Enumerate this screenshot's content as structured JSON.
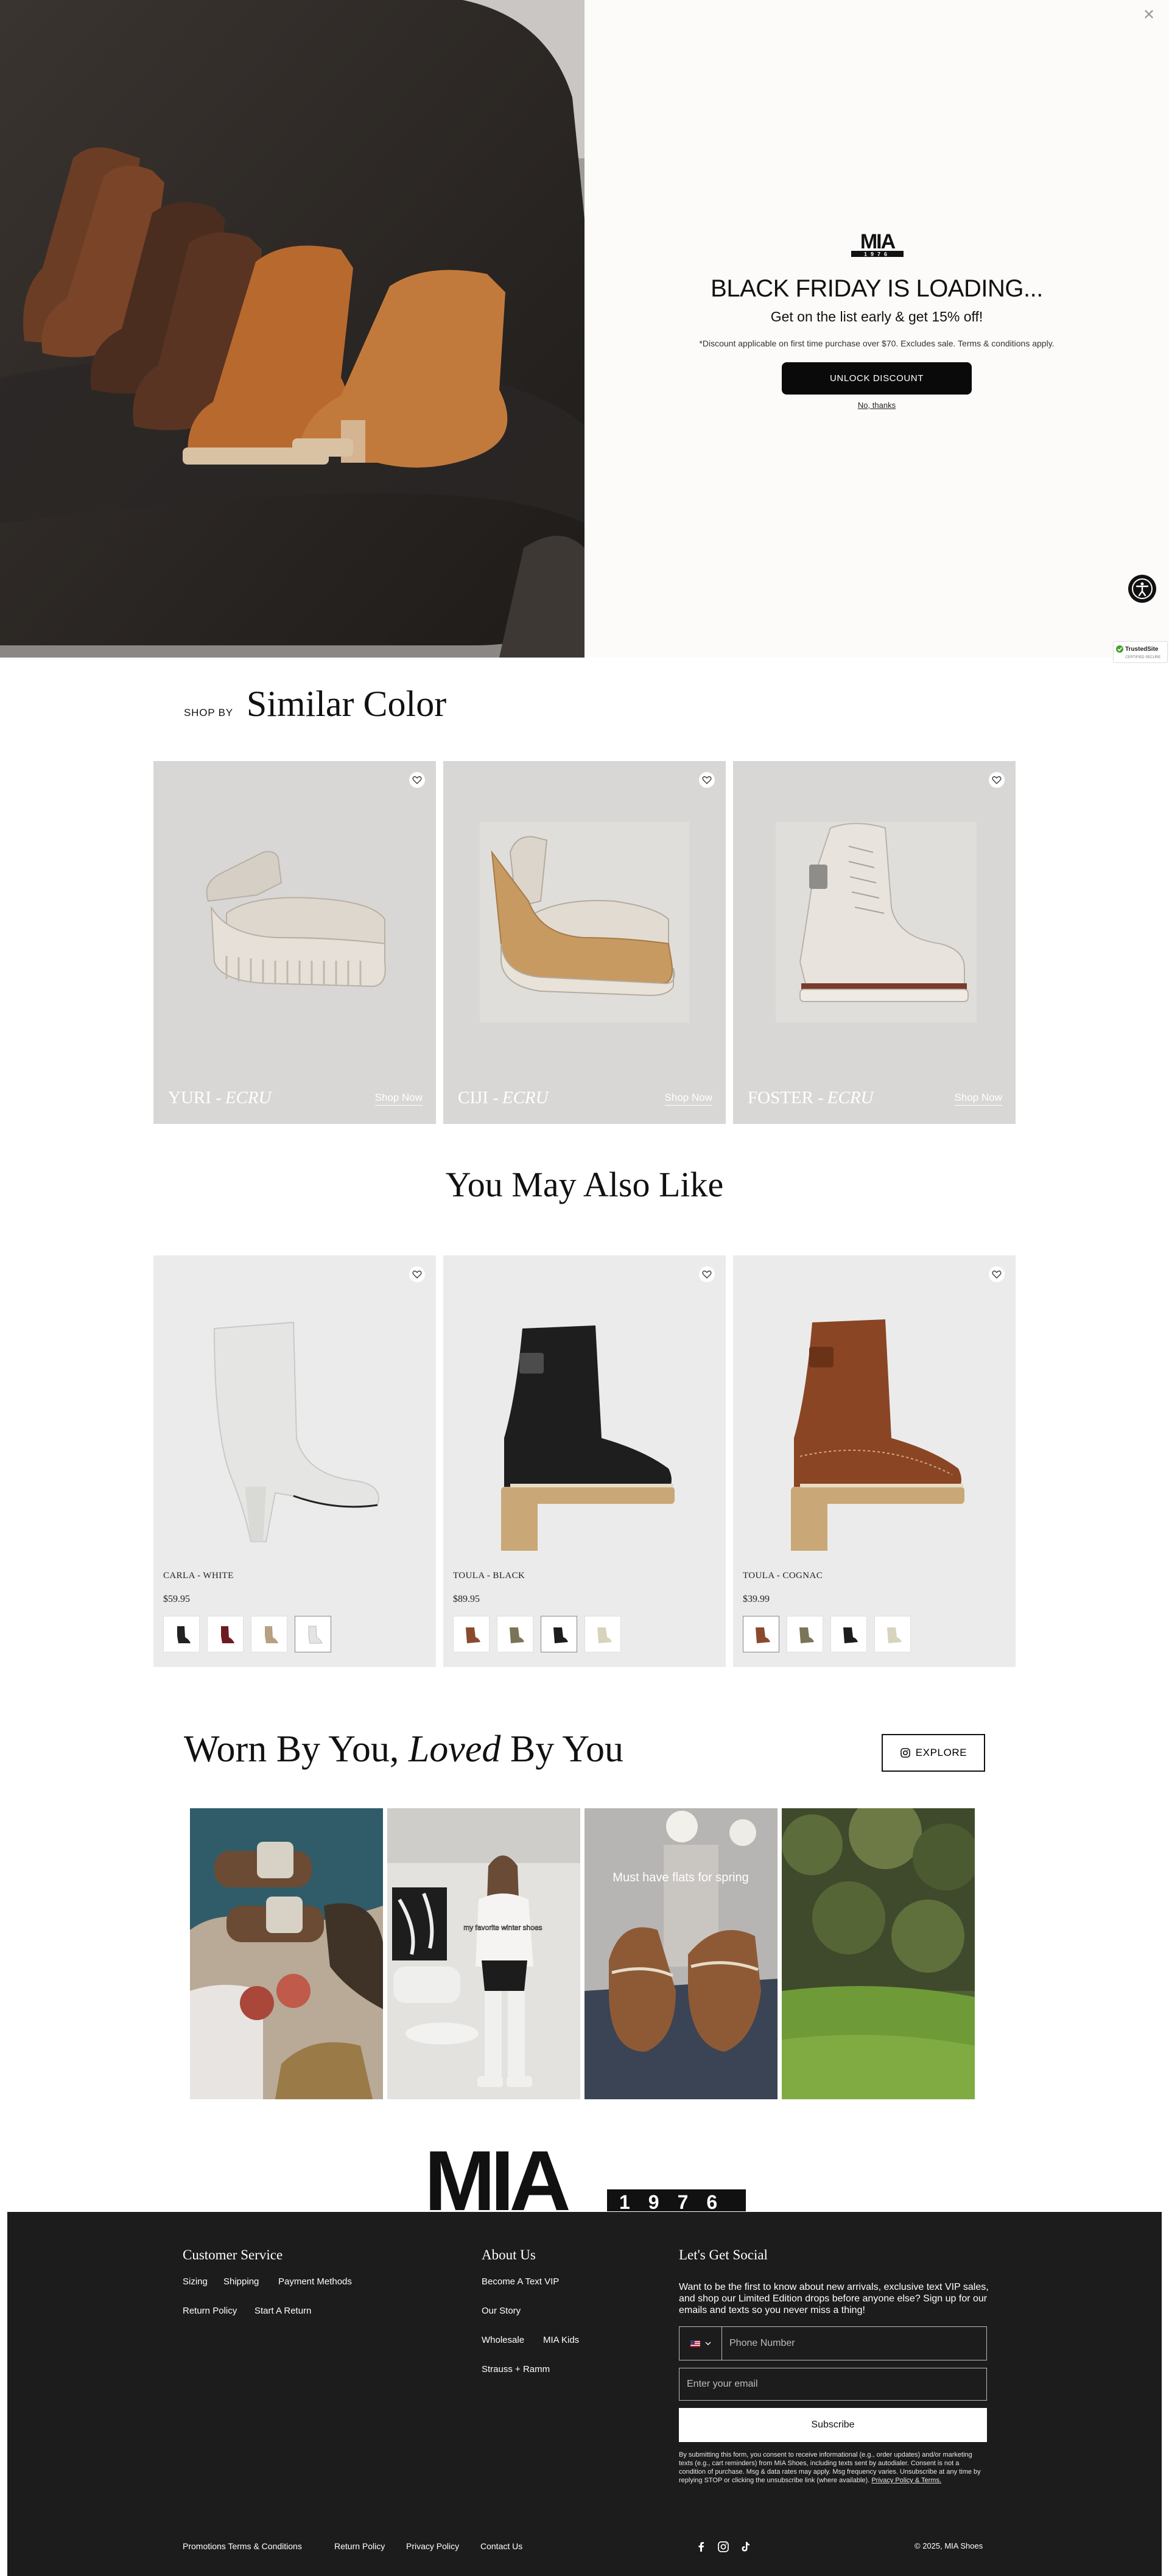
{
  "popup": {
    "close_icon": "close-icon",
    "logo_text": "MIA",
    "logo_year": "1976",
    "headline": "BLACK FRIDAY IS LOADING...",
    "subheadline": "Get on the list early & get 15% off!",
    "terms": "*Discount applicable on first time purchase over $70. Excludes sale. Terms & conditions apply.",
    "unlock_label": "UNLOCK DISCOUNT",
    "no_thanks_label": "No, thanks"
  },
  "badge": {
    "line1": "TrustedSite",
    "line2": "CERTIFIED SECURE"
  },
  "similar": {
    "shop_by": "SHOP BY",
    "title": "Similar Color",
    "cards": [
      {
        "name": "YURI",
        "color": "ECRU",
        "cta": "Shop Now"
      },
      {
        "name": "CIJI",
        "color": "ECRU",
        "cta": "Shop Now"
      },
      {
        "name": "FOSTER",
        "color": "ECRU",
        "cta": "Shop Now"
      }
    ]
  },
  "ymal": {
    "title": "You May Also Like",
    "products": [
      {
        "name": "CARLA - WHITE",
        "price": "$59.95",
        "swatches": [
          "#222222",
          "#6d1a22",
          "#b7a082",
          "#e4e4e4"
        ]
      },
      {
        "name": "TOULA - BLACK",
        "price": "$89.95",
        "swatches": [
          "#8a4a2c",
          "#7a7458",
          "#1c1c1c",
          "#d8d3bd"
        ]
      },
      {
        "name": "TOULA - COGNAC",
        "price": "$39.99",
        "swatches": [
          "#8a4a2c",
          "#7a7458",
          "#1c1c1c",
          "#d8d3bd"
        ]
      }
    ]
  },
  "worn": {
    "title_start": "Worn By You,",
    "title_italic": "Loved",
    "title_end": "By You",
    "explore_label": "EXPLORE",
    "ugc2_caption": "my favorite winter shoes",
    "ugc3_caption": "Must have flats for spring"
  },
  "footer": {
    "logo_text": "MIA",
    "logo_year": "1976",
    "customer_service": {
      "heading": "Customer Service",
      "links": [
        "Sizing",
        "Shipping",
        "Payment Methods",
        "Return Policy",
        "Start A Return"
      ]
    },
    "about": {
      "heading": "About Us",
      "links": [
        "Become A Text VIP",
        "Our Story",
        "Wholesale",
        "MIA Kids",
        "Strauss + Ramm"
      ]
    },
    "social": {
      "heading": "Let's Get Social",
      "text": "Want to be the first to know about new arrivals, exclusive text VIP sales, and shop our Limited Edition drops before anyone else? Sign up for our emails and texts so you never miss a thing!",
      "phone_placeholder": "Phone Number",
      "email_placeholder": "Enter your email",
      "subscribe_label": "Subscribe",
      "consent": "By submitting this form, you consent to receive informational (e.g., order updates) and/or marketing texts (e.g., cart reminders) from MIA Shoes, including texts sent by autodialer. Consent is not a condition of purchase. Msg & data rates may apply. Msg frequency varies. Unsubscribe at any time by replying STOP or clicking the unsubscribe link (where available).",
      "consent_link": "Privacy Policy & Terms."
    },
    "bottom_links": [
      "Promotions Terms & Conditions",
      "Return Policy",
      "Privacy Policy",
      "Contact Us"
    ],
    "copyright": "© 2025, MIA Shoes"
  }
}
